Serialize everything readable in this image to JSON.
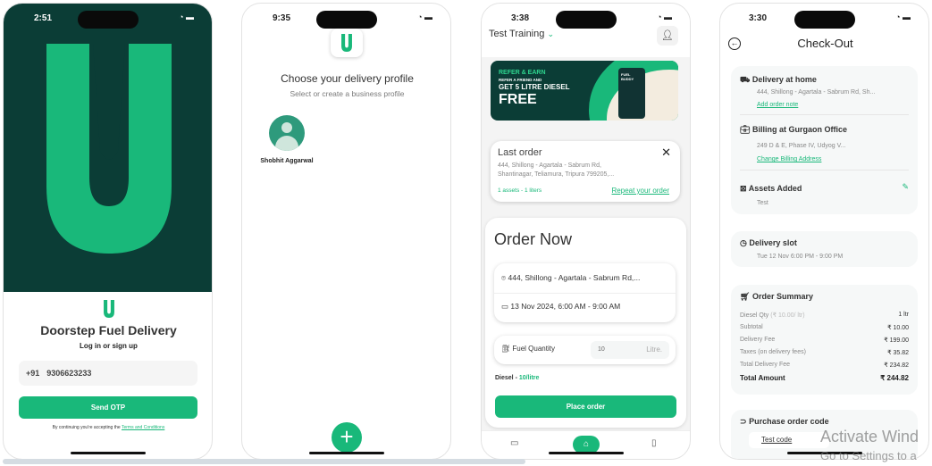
{
  "colors": {
    "brand_green": "#19b87a",
    "dark_green": "#0b3d36"
  },
  "login": {
    "time": "2:51",
    "title": "Doorstep Fuel Delivery",
    "subtitle": "Log in or sign up",
    "country_code": "+91",
    "phone": "9306623233",
    "send_otp": "Send OTP",
    "terms_prefix": "By continuing you're accepting the",
    "terms_link": "Terms and Conditions"
  },
  "profile": {
    "time": "9:35",
    "title": "Choose your delivery profile",
    "subtitle": "Select or create a business profile",
    "profiles": [
      {
        "name": "Shobhit Aggarwal"
      }
    ],
    "add_icon": "plus-icon"
  },
  "home": {
    "time": "3:38",
    "account": "Test Training",
    "banner": {
      "line1": "REFER & EARN",
      "line2": "REFER A FRIEND AND",
      "line3": "GET 5 LITRE DIESEL",
      "line4": "FREE",
      "brand": "FUEL BUDDY"
    },
    "last_order": {
      "title": "Last order",
      "address": "444, Shillong - Agartala - Sabrum Rd, Shantinagar, Teliamura, Tripura 799205,...",
      "summary": "1 assets - 1 liters",
      "repeat": "Repeat your order"
    },
    "order_now": {
      "title": "Order Now",
      "address": "444, Shillong - Agartala - Sabrum Rd,...",
      "slot": "13 Nov 2024, 6:00 AM - 9:00 AM",
      "fuel_label": "Fuel Quantity",
      "quantity": "10",
      "unit": "Litre.",
      "fuel_type": "Diesel - ",
      "price": "10/litre",
      "place_order": "Place order"
    }
  },
  "checkout": {
    "time": "3:30",
    "title": "Check-Out",
    "delivery": {
      "title": "Delivery at home",
      "address": "444, Shillong - Agartala - Sabrum Rd, Sh...",
      "link": "Add order note"
    },
    "billing": {
      "title": "Billing at Gurgaon Office",
      "address": "249 D & E, Phase IV, Udyog V...",
      "link": "Change Billing Address"
    },
    "assets": {
      "title": "Assets Added",
      "value": "Test"
    },
    "slot": {
      "title": "Delivery slot",
      "value": "Tue 12 Nov 6:00 PM - 9:00 PM"
    },
    "summary": {
      "title": "Order Summary",
      "rows": [
        {
          "label": "Diesel Qty",
          "note": "(₹ 10.00/ ltr)",
          "value": "1 ltr"
        },
        {
          "label": "Subtotal",
          "value": "₹ 10.00"
        },
        {
          "label": "Delivery Fee",
          "value": "₹ 199.00"
        },
        {
          "label": "Taxes (on delivery fees)",
          "value": "₹ 35.82"
        },
        {
          "label": "Total Delivery Fee",
          "value": "₹ 234.82"
        },
        {
          "label": "Total Amount",
          "value": "₹ 244.82"
        }
      ]
    },
    "po": {
      "title": "Purchase order code",
      "value": "Test code"
    }
  },
  "watermark": {
    "line1": "Activate Wind",
    "line2": "Go to Settings to a"
  }
}
